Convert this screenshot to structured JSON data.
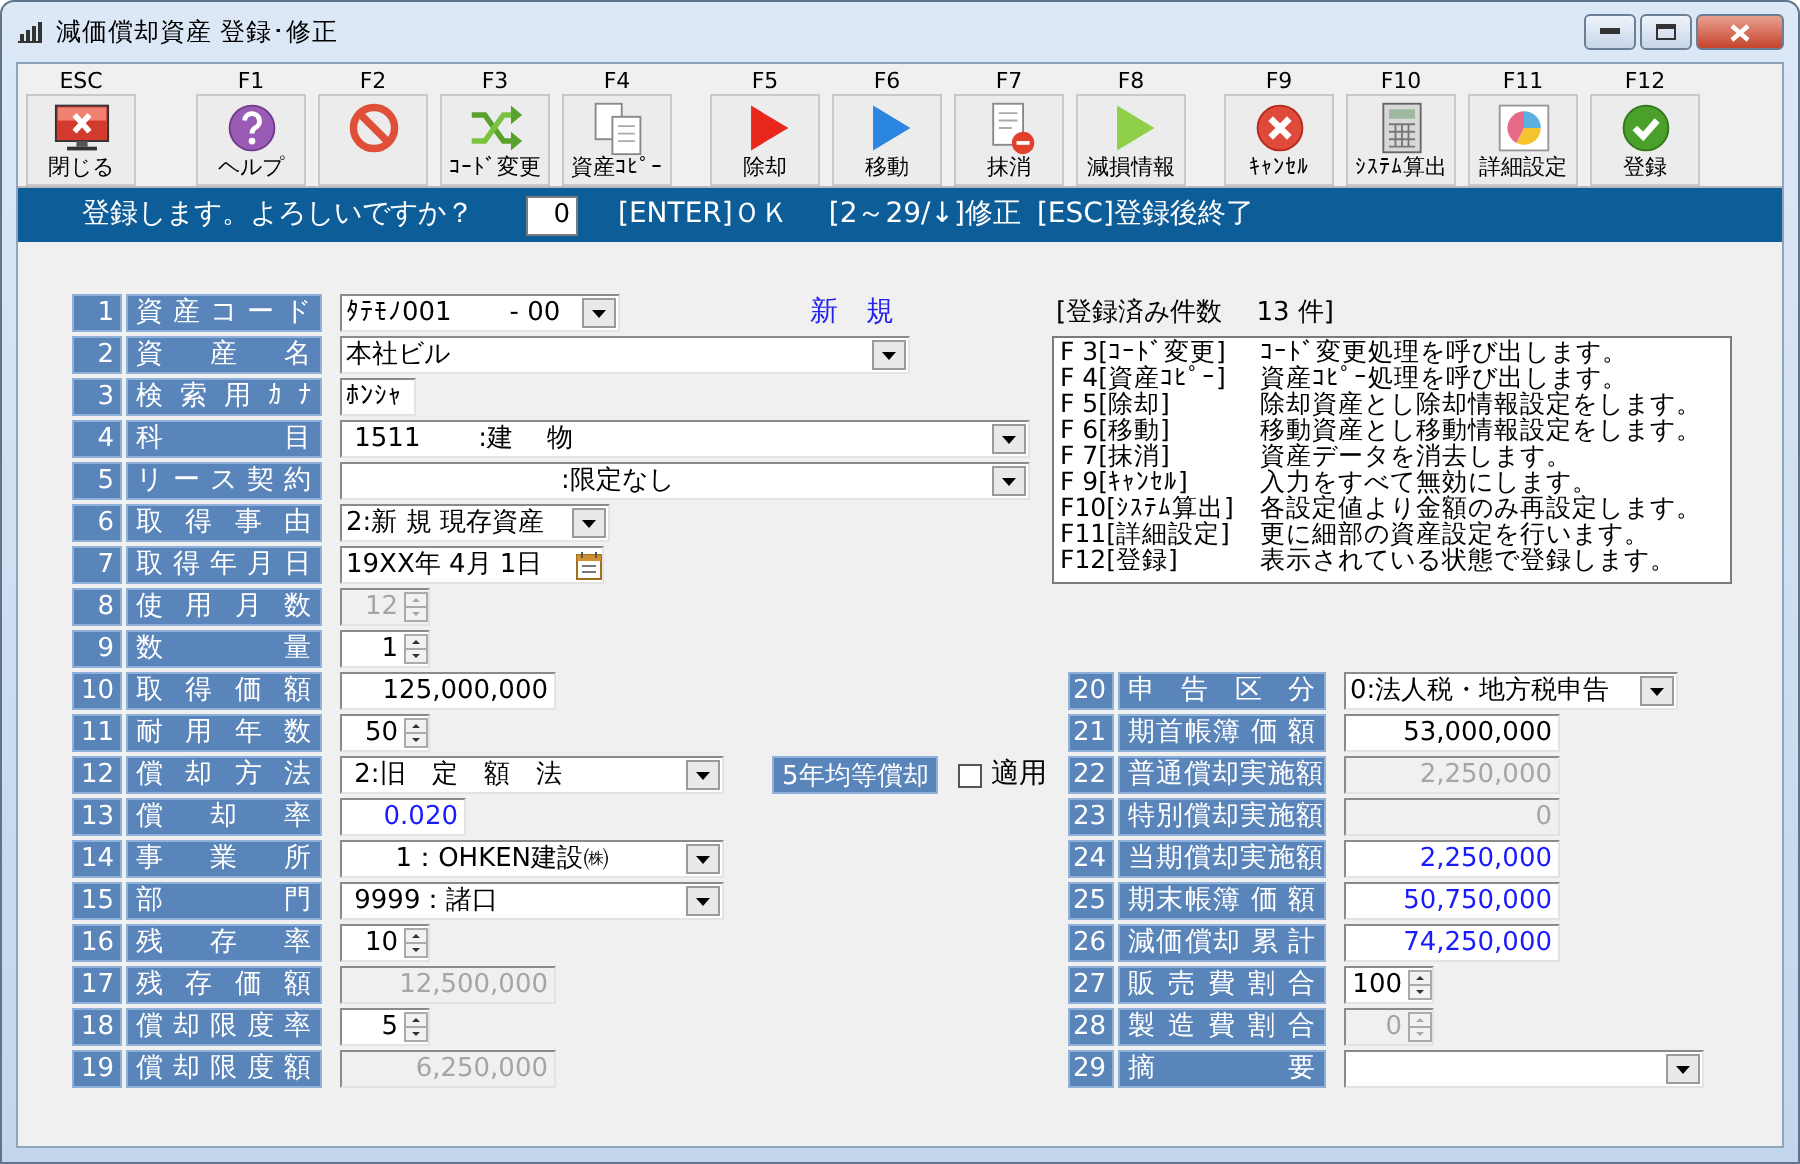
{
  "window": {
    "title": "減価償却資産 登録･修正"
  },
  "toolbar": [
    {
      "buttons": [
        {
          "key": "ESC",
          "label": "閉じる",
          "kind": "monitor-x"
        }
      ]
    },
    {
      "buttons": [
        {
          "key": "F1",
          "label": "ヘルプ",
          "kind": "help"
        },
        {
          "key": "F2",
          "kind": "no-entry"
        },
        {
          "key": "F3",
          "label": "ｺｰﾄﾞ変更",
          "kind": "shuffle"
        },
        {
          "key": "F4",
          "label": "資産ｺﾋﾟｰ",
          "kind": "documents"
        }
      ]
    },
    {
      "buttons": [
        {
          "key": "F5",
          "label": "除却",
          "kind": "play-red"
        },
        {
          "key": "F6",
          "label": "移動",
          "kind": "play-blue"
        },
        {
          "key": "F7",
          "label": "抹消",
          "kind": "document-minus"
        },
        {
          "key": "F8",
          "label": "減損情報",
          "kind": "play-green"
        }
      ]
    },
    {
      "buttons": [
        {
          "key": "F9",
          "label": "ｷｬﾝｾﾙ",
          "kind": "cancel"
        },
        {
          "key": "F10",
          "label": "ｼｽﾃﾑ算出",
          "kind": "calculator"
        },
        {
          "key": "F11",
          "label": "詳細設定",
          "kind": "pie-chart"
        },
        {
          "key": "F12",
          "label": "登録",
          "kind": "check"
        }
      ]
    }
  ],
  "prompt": {
    "text": "登録します。よろしいですか？",
    "value": "0",
    "hints": [
      "[ENTER]ＯＫ",
      "[2～29/↓]修正",
      "[ESC]登録後終了"
    ]
  },
  "left_fields": [
    {
      "no": "1",
      "label": "資産コード",
      "kind": "combo",
      "value": "ﾀﾃﾓﾉ001       - 00",
      "disabled": false,
      "computed": false,
      "status": "新　規"
    },
    {
      "no": "2",
      "label": "資産名",
      "kind": "combo",
      "value": "本社ビル",
      "disabled": false,
      "computed": false
    },
    {
      "no": "3",
      "label": "検索用ｶﾅ",
      "kind": "text",
      "value": "ﾎﾝｼｬ",
      "disabled": false,
      "computed": false
    },
    {
      "no": "4",
      "label": "科目",
      "kind": "combo",
      "value": " 1511       :建　 物",
      "disabled": false,
      "computed": false
    },
    {
      "no": "5",
      "label": "リース契約",
      "kind": "combo",
      "value": "                          :限定なし",
      "disabled": false,
      "computed": false
    },
    {
      "no": "6",
      "label": "取得事由",
      "kind": "combo",
      "value": "2:新 規 現存資産",
      "disabled": false,
      "computed": false
    },
    {
      "no": "7",
      "label": "取得年月日",
      "kind": "date",
      "value": "19XX年 4月 1日",
      "disabled": false,
      "computed": false
    },
    {
      "no": "8",
      "label": "使用月数",
      "kind": "spin",
      "value": "12",
      "disabled": true,
      "computed": false
    },
    {
      "no": "9",
      "label": "数量",
      "kind": "spin",
      "value": "1",
      "disabled": false,
      "computed": false
    },
    {
      "no": "10",
      "label": "取得価額",
      "kind": "number",
      "value": "125,000,000",
      "disabled": false,
      "computed": false
    },
    {
      "no": "11",
      "label": "耐用年数",
      "kind": "spin",
      "value": "50",
      "disabled": false,
      "computed": false
    },
    {
      "no": "12",
      "label": "償却方法",
      "kind": "combo",
      "value": " 2:旧　定　額　法",
      "disabled": false,
      "computed": false,
      "tag": "5年均等償却",
      "checkbox": {
        "label": "適用",
        "checked": false
      }
    },
    {
      "no": "13",
      "label": "償却率",
      "kind": "number",
      "value": "0.020",
      "disabled": false,
      "computed": true
    },
    {
      "no": "14",
      "label": "事業所",
      "kind": "combo",
      "value": "      1：OHKEN建設㈱",
      "disabled": false,
      "computed": false
    },
    {
      "no": "15",
      "label": "部門",
      "kind": "combo",
      "value": " 9999：諸口",
      "disabled": false,
      "computed": false
    },
    {
      "no": "16",
      "label": "残存率",
      "kind": "spin",
      "value": "10",
      "disabled": false,
      "computed": false
    },
    {
      "no": "17",
      "label": "残存価額",
      "kind": "number",
      "value": "12,500,000",
      "disabled": true,
      "computed": false
    },
    {
      "no": "18",
      "label": "償却限度率",
      "kind": "spin",
      "value": "5",
      "disabled": false,
      "computed": false
    },
    {
      "no": "19",
      "label": "償却限度額",
      "kind": "number",
      "value": "6,250,000",
      "disabled": true,
      "computed": false
    }
  ],
  "registered_count": "[登録済み件数　 13 件]",
  "help_lines": [
    {
      "key": "F 3[ｺｰﾄﾞ変更]",
      "text": "ｺｰﾄﾞ変更処理を呼び出します。"
    },
    {
      "key": "F 4[資産ｺﾋﾟｰ]",
      "text": "資産ｺﾋﾟｰ処理を呼び出します。"
    },
    {
      "key": "F 5[除却]",
      "text": "除却資産とし除却情報設定をします。"
    },
    {
      "key": "F 6[移動]",
      "text": "移動資産とし移動情報設定をします。"
    },
    {
      "key": "F 7[抹消]",
      "text": "資産データを消去します。"
    },
    {
      "key": "F 9[ｷｬﾝｾﾙ]",
      "text": "入力をすべて無効にします。"
    },
    {
      "key": "F10[ｼｽﾃﾑ算出]",
      "text": "各設定値より金額のみ再設定します。"
    },
    {
      "key": "F11[詳細設定]",
      "text": "更に細部の資産設定を行います。"
    },
    {
      "key": "F12[登録]",
      "text": "表示されている状態で登録します。"
    }
  ],
  "right_fields": [
    {
      "no": "20",
      "label": "申告区分",
      "kind": "combo",
      "value": "0:法人税・地方税申告",
      "disabled": false,
      "computed": false
    },
    {
      "no": "21",
      "label": "期首帳簿 価 額",
      "kind": "number",
      "value": "53,000,000",
      "disabled": false,
      "computed": false
    },
    {
      "no": "22",
      "label": "普通償却実施額",
      "kind": "number",
      "value": "2,250,000",
      "disabled": true,
      "computed": false
    },
    {
      "no": "23",
      "label": "特別償却実施額",
      "kind": "number",
      "value": "0",
      "disabled": true,
      "computed": false
    },
    {
      "no": "24",
      "label": "当期償却実施額",
      "kind": "number",
      "value": "2,250,000",
      "disabled": false,
      "computed": true
    },
    {
      "no": "25",
      "label": "期末帳簿 価 額",
      "kind": "number",
      "value": "50,750,000",
      "disabled": false,
      "computed": true
    },
    {
      "no": "26",
      "label": "減価償却 累 計",
      "kind": "number",
      "value": "74,250,000",
      "disabled": false,
      "computed": true
    },
    {
      "no": "27",
      "label": "販売費割合",
      "kind": "spin",
      "value": "100",
      "disabled": false,
      "computed": false
    },
    {
      "no": "28",
      "label": "製造費割合",
      "kind": "spin",
      "value": "0",
      "disabled": true,
      "computed": false
    },
    {
      "no": "29",
      "label": "摘要",
      "kind": "combo",
      "disabled": false
    }
  ]
}
